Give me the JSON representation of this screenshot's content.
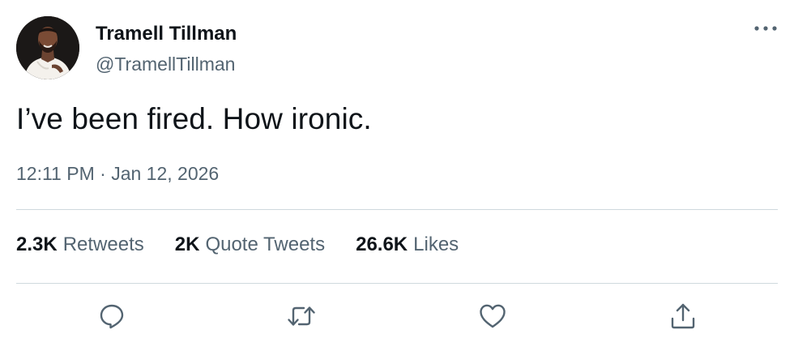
{
  "author": {
    "display_name": "Tramell Tillman",
    "handle": "@TramellTillman"
  },
  "tweet": {
    "text": "I’ve been fired. How ironic.",
    "time": "12:11 PM",
    "separator": " · ",
    "date": "Jan 12, 2026"
  },
  "stats": [
    {
      "count": "2.3K",
      "label": "Retweets"
    },
    {
      "count": "2K",
      "label": "Quote Tweets"
    },
    {
      "count": "26.6K",
      "label": "Likes"
    }
  ],
  "icons": {
    "more": "more-horizontal-icon",
    "reply": "reply-icon",
    "retweet": "retweet-icon",
    "like": "heart-icon",
    "share": "share-icon"
  },
  "colors": {
    "text_primary": "#0f1419",
    "text_secondary": "#536471",
    "divider": "#cfd9de",
    "icon": "#536471"
  }
}
